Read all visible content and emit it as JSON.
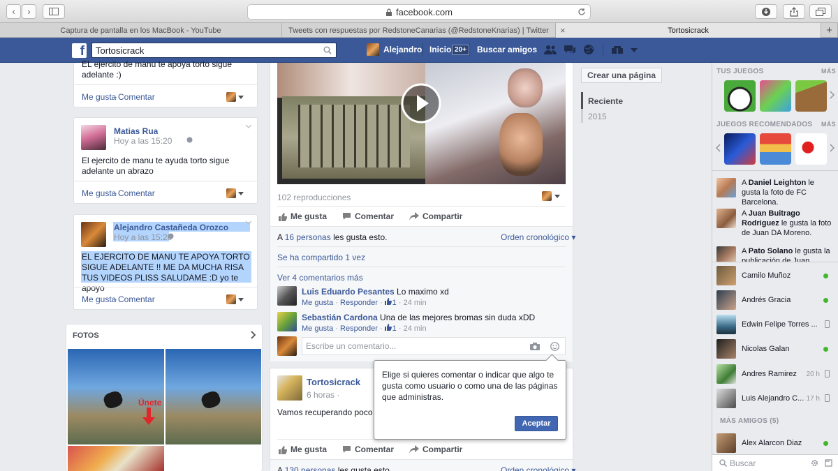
{
  "browser": {
    "url": "facebook.com",
    "tabs": [
      "Captura de pantalla en los MacBook - YouTube",
      "Tweets con respuestas por RedstoneCanarias (@RedstoneKnarias) | Twitter",
      "Tortosicrack"
    ],
    "close": "×",
    "newtab": "+"
  },
  "fb": {
    "logo": "f",
    "search_value": "Tortosicrack",
    "user": "Alejandro",
    "home": "Inicio",
    "home_badge": "20+",
    "find_friends": "Buscar amigos"
  },
  "left": {
    "c1": {
      "text": "EL ejercito de manu te apoya torto sigue adelante :)",
      "like": "Me gusta",
      "sep": "·",
      "comment": "Comentar"
    },
    "c2": {
      "name": "Matias Rua",
      "time": "Hoy a las 15:20",
      "text": "El ejercito de manu te ayuda torto sigue adelante un abrazo",
      "like": "Me gusta",
      "comment": "Comentar"
    },
    "c3": {
      "name": "Alejandro Castañeda Orozco",
      "time": "Hoy a las 15:20",
      "text": "EL EJERCITO DE MANU TE APOYA TORTO SIGUE ADELANTE !! ME DA MUCHA RISA TUS VIDEOS PLISS SALUDAME :D yo te apoyo",
      "like": "Me gusta",
      "comment": "Comentar"
    },
    "photos": {
      "title": "FOTOS",
      "overlay": "Únete"
    }
  },
  "center": {
    "views": "102 reproducciones",
    "actions": {
      "like": "Me gusta",
      "comment": "Comentar",
      "share": "Compartir"
    },
    "likes_pre": "A ",
    "likes_link": "16 personas",
    "likes_post": " les gusta esto.",
    "order": "Orden cronológico",
    "shared": "Se ha compartido 1 vez",
    "more_comments": "Ver 4 comentarios más",
    "comments": [
      {
        "name": "Luis Eduardo Pesantes",
        "text": "Lo maximo xd",
        "like": "Me gusta",
        "reply": "Responder",
        "count": "1",
        "time": "24 min"
      },
      {
        "name": "Sebastián Cardona",
        "text": "Una de las mejores bromas sin duda xDD",
        "like": "Me gusta",
        "reply": "Responder",
        "count": "1",
        "time": "24 min"
      }
    ],
    "write_placeholder": "Escribe un comentario...",
    "post2": {
      "name": "Tortosicrack",
      "time": "6 horas",
      "text": "Vamos recuperando poco",
      "likes_pre": "A ",
      "likes_link": "130 personas",
      "likes_post": " les gusta esto.",
      "order": "Orden cronológico"
    }
  },
  "timeline": {
    "create_page": "Crear una página",
    "recent": "Reciente",
    "year": "2015"
  },
  "tooltip": {
    "text": "Elige si quieres comentar o indicar que algo te gusta como usuario o como una de las páginas que administras.",
    "button": "Aceptar"
  },
  "right": {
    "your_games": "TUS JUEGOS",
    "more": "MÁS",
    "rec_games": "JUEGOS RECOMENDADOS",
    "ticker": [
      {
        "pre": "A ",
        "name": "Daniel Leighton",
        "post": " le gusta la foto de FC Barcelona."
      },
      {
        "pre": "A ",
        "name": "Juan Buitrago Rodriguez",
        "post": " le gusta la foto de Juan DA Moreno."
      },
      {
        "pre": "A ",
        "name": "Pato Solano",
        "post": " le gusta la publicación de Juan"
      }
    ],
    "chat": [
      {
        "name": "Camilo Muñoz",
        "status": "online",
        "time": ""
      },
      {
        "name": "Andrés Gracia",
        "status": "online",
        "time": ""
      },
      {
        "name": "Edwin Felipe Torres ...",
        "status": "mobile",
        "time": ""
      },
      {
        "name": "Nicolas Galan",
        "status": "online",
        "time": ""
      },
      {
        "name": "Andres Ramirez",
        "status": "mobile",
        "time": "20 h"
      },
      {
        "name": "Luis Alejandro C...",
        "status": "mobile",
        "time": "17 h"
      }
    ],
    "more_friends": "MÁS AMIGOS (5)",
    "more_friend": {
      "name": "Alex Alarcon Diaz"
    },
    "search": "Buscar"
  }
}
